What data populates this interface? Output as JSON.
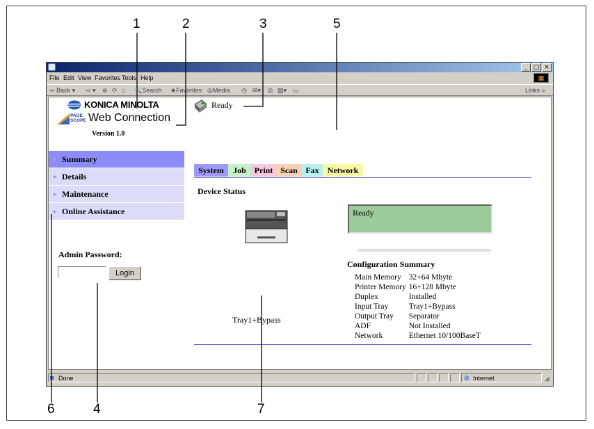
{
  "callouts": {
    "c1": "1",
    "c2": "2",
    "c3": "3",
    "c4": "4",
    "c5": "5",
    "c6": "6",
    "c7": "7"
  },
  "window": {
    "menu": [
      "File",
      "Edit",
      "View",
      "Favorites",
      "Tools",
      "Help"
    ],
    "toolbar": {
      "back": "Back",
      "search": "Search",
      "favorites": "Favorites",
      "media": "Media",
      "links": "Links"
    },
    "status": {
      "left": "Done",
      "zone": "Internet"
    }
  },
  "header": {
    "brand": "KONICA MINOLTA",
    "product_small": "PAGE SCOPE",
    "product": "Web Connection",
    "version": "Version 1.0",
    "status": "Ready"
  },
  "tabs": [
    {
      "label": "System",
      "color": "#9c9cf8"
    },
    {
      "label": "Job",
      "color": "#c8f0c8"
    },
    {
      "label": "Print",
      "color": "#f8c8dc"
    },
    {
      "label": "Scan",
      "color": "#f8d0b4"
    },
    {
      "label": "Fax",
      "color": "#b8f0f0"
    },
    {
      "label": "Network",
      "color": "#f8f8a4"
    }
  ],
  "sidebar": {
    "items": [
      {
        "label": "Summary"
      },
      {
        "label": "Details"
      },
      {
        "label": "Maintenance"
      },
      {
        "label": "Online Assistance"
      }
    ],
    "admin_label": "Admin Password:",
    "password_value": "",
    "login_label": "Login"
  },
  "main": {
    "section_title": "Device Status",
    "status_box": "Ready",
    "tray_label": "Tray1+Bypass",
    "config_title": "Configuration Summary",
    "config": [
      {
        "key": "Main Memory",
        "value": "32+64 Mbyte"
      },
      {
        "key": "Printer Memory",
        "value": "16+128 Mbyte"
      },
      {
        "key": "Duplex",
        "value": "Installed"
      },
      {
        "key": "Input Tray",
        "value": "Tray1+Bypass"
      },
      {
        "key": "Output Tray",
        "value": "Separator"
      },
      {
        "key": "ADF",
        "value": "Not Installed"
      },
      {
        "key": "Network",
        "value": "Ethernet 10/100BaseT"
      }
    ]
  },
  "colors": {
    "status_green": "#9ccc9c",
    "nav_active": "#8c8cf8",
    "nav_bg": "#dcdcf8",
    "rule": "#6c6cc8"
  }
}
